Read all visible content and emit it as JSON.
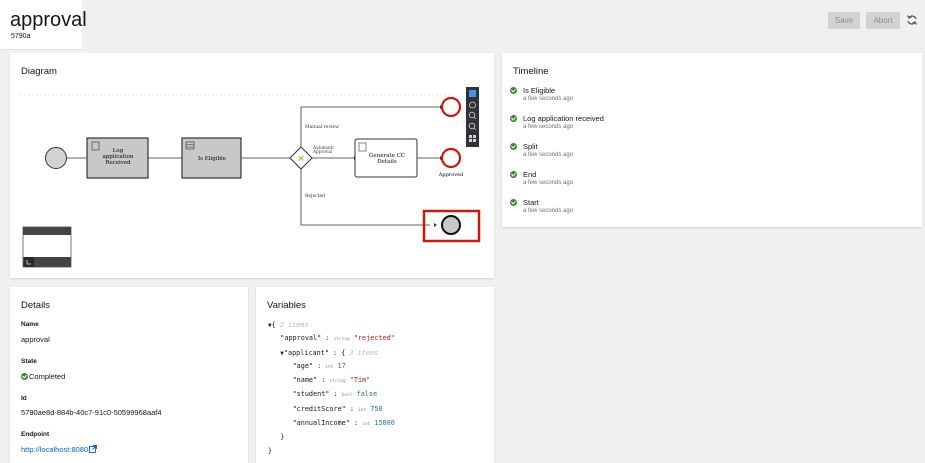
{
  "header": {
    "title": "approval",
    "subtitle": "5790a",
    "save_label": "Save",
    "abort_label": "Abort"
  },
  "diagram": {
    "title": "Diagram",
    "nodes": {
      "log_application": [
        "Log",
        "application",
        "Received"
      ],
      "is_eligible": "Is Eligible",
      "generate_cc": [
        "Generate CC",
        "Details"
      ],
      "approved_label": "Approved",
      "gateway_label": [
        "Automatic",
        "Approval"
      ],
      "manual_review_label": "Manual review",
      "rejected_label": "Rejected"
    },
    "highlight_color": "#c9190b",
    "toolbar_icons": [
      "cursor-icon",
      "pan-icon",
      "zoom-in-icon",
      "zoom-out-icon",
      "fit-icon"
    ]
  },
  "timeline": {
    "title": "Timeline",
    "items": [
      {
        "label": "Is Eligible",
        "time": "a few seconds ago"
      },
      {
        "label": "Log application received",
        "time": "a few seconds ago"
      },
      {
        "label": "Split",
        "time": "a few seconds ago"
      },
      {
        "label": "End",
        "time": "a few seconds ago"
      },
      {
        "label": "Start",
        "time": "a few seconds ago"
      }
    ]
  },
  "details": {
    "title": "Details",
    "name_label": "Name",
    "name_value": "approval",
    "state_label": "State",
    "state_value": "Completed",
    "id_label": "Id",
    "id_value": "5790ae8d-884b-40c7-91c0-50599968aaf4",
    "endpoint_label": "Endpoint",
    "endpoint_value": "http://localhost:8080"
  },
  "variables": {
    "title": "Variables",
    "root_count": "2 items",
    "approval_key": "\"approval\"",
    "approval_type": "string",
    "approval_value": "\"rejected\"",
    "applicant_key": "\"applicant\"",
    "applicant_count": "3 items",
    "age_key": "\"age\"",
    "age_type": "int",
    "age_value": "17",
    "name_key": "\"name\"",
    "name_type": "string",
    "name_value": "\"Tim\"",
    "student_key": "\"student\"",
    "student_type": "bool",
    "student_value": "false",
    "credit_key": "\"creditScore\"",
    "credit_type": "int",
    "credit_value": "750",
    "income_key": "\"annualIncome\"",
    "income_type": "int",
    "income_value": "15000"
  },
  "colors": {
    "success": "#3e8635",
    "link": "#06c",
    "task_fill": "#c8c8c8",
    "gateway_fill": "#e8a33c"
  }
}
